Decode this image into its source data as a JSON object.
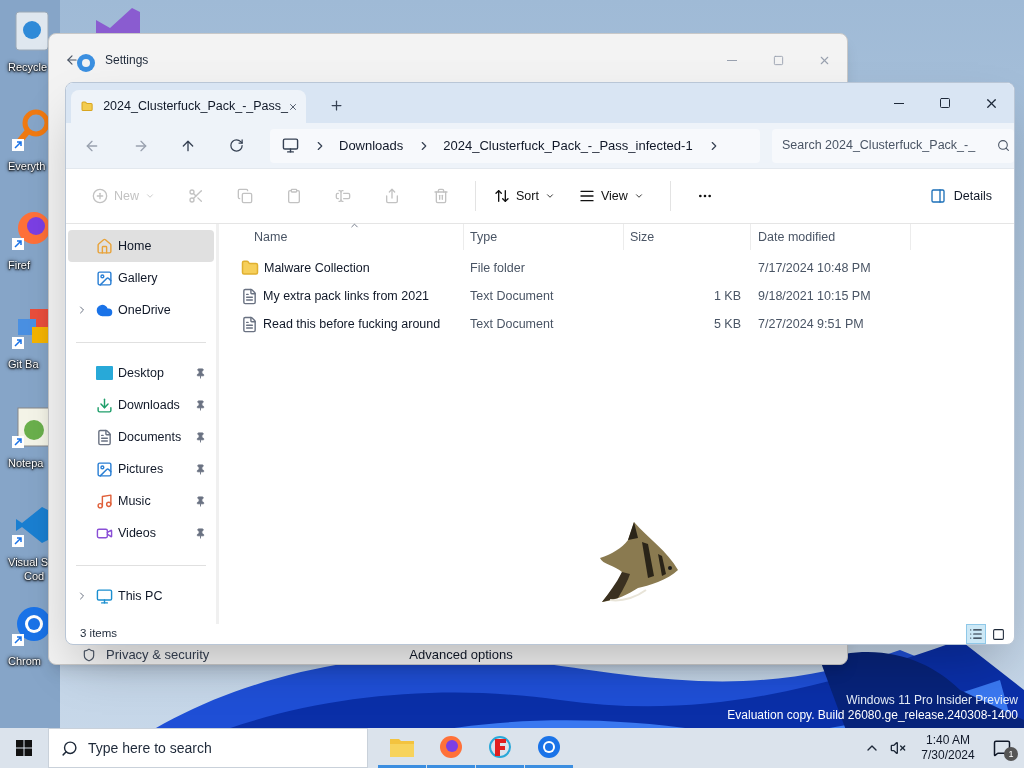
{
  "desktop_icons": [
    {
      "kind": "recycle",
      "lines": [
        "Recycle"
      ]
    },
    {
      "kind": "everything",
      "lines": [
        "Everyth"
      ]
    },
    {
      "kind": "firefox",
      "lines": [
        "Firef"
      ]
    },
    {
      "kind": "git",
      "lines": [
        "Git Ba"
      ]
    },
    {
      "kind": "notepad",
      "lines": [
        "Notepa"
      ]
    },
    {
      "kind": "vscode",
      "lines": [
        "Visual S",
        "Cod"
      ]
    },
    {
      "kind": "chrome",
      "lines": [
        "Chrom"
      ]
    }
  ],
  "settings_window": {
    "title": "Settings",
    "nav_item": "Privacy & security",
    "footer_link": "Advanced options"
  },
  "explorer": {
    "tab_title": "2024_Clusterfuck_Pack_-_Pass_",
    "breadcrumb": [
      "Downloads",
      "2024_Clusterfuck_Pack_-_Pass_infected-1"
    ],
    "search": {
      "placeholder": "Search 2024_Clusterfuck_Pack_-_"
    },
    "toolbar": [
      {
        "kind": "new",
        "label": "New",
        "disabled": true
      },
      {
        "kind": "cut",
        "disabled": true
      },
      {
        "kind": "copy",
        "disabled": true
      },
      {
        "kind": "paste",
        "disabled": true
      },
      {
        "kind": "rename",
        "disabled": true
      },
      {
        "kind": "share",
        "disabled": true
      },
      {
        "kind": "delete",
        "disabled": true
      },
      {
        "kind": "sort",
        "label": "Sort",
        "disabled": false
      },
      {
        "kind": "view",
        "label": "View",
        "disabled": false
      },
      {
        "kind": "more",
        "disabled": false
      }
    ],
    "details_button": "Details",
    "sidebar": {
      "sections": [
        [
          {
            "kind": "home",
            "label": "Home",
            "selected": true,
            "expandable": false,
            "pinned": false
          },
          {
            "kind": "gallery",
            "label": "Gallery",
            "selected": false,
            "expandable": false,
            "pinned": false
          },
          {
            "kind": "onedrive",
            "label": "OneDrive",
            "selected": false,
            "expandable": true,
            "pinned": false
          }
        ],
        [
          {
            "kind": "desktop",
            "label": "Desktop",
            "selected": false,
            "expandable": false,
            "pinned": true
          },
          {
            "kind": "downloads",
            "label": "Downloads",
            "selected": false,
            "expandable": false,
            "pinned": true
          },
          {
            "kind": "documents",
            "label": "Documents",
            "selected": false,
            "expandable": false,
            "pinned": true
          },
          {
            "kind": "pictures",
            "label": "Pictures",
            "selected": false,
            "expandable": false,
            "pinned": true
          },
          {
            "kind": "music",
            "label": "Music",
            "selected": false,
            "expandable": false,
            "pinned": true
          },
          {
            "kind": "videos",
            "label": "Videos",
            "selected": false,
            "expandable": false,
            "pinned": true
          }
        ],
        [
          {
            "kind": "thispc",
            "label": "This PC",
            "selected": false,
            "expandable": true,
            "pinned": false
          }
        ]
      ]
    },
    "table": {
      "columns": [
        {
          "label": "Name",
          "sorted": true
        },
        {
          "label": "Type",
          "sorted": false
        },
        {
          "label": "Size",
          "sorted": false
        },
        {
          "label": "Date modified",
          "sorted": false
        }
      ],
      "rows": [
        {
          "kind": "folder",
          "name": "Malware Collection",
          "type": "File folder",
          "date": "7/17/2024 10:48 PM"
        },
        {
          "kind": "text",
          "name": "My extra pack links from 2021",
          "type": "Text Document",
          "size": "1 KB",
          "date": "9/18/2021 10:15 PM"
        },
        {
          "kind": "text",
          "name": "Read this before fucking around",
          "type": "Text Document",
          "size": "5 KB",
          "date": "7/27/2024 9:51 PM"
        }
      ]
    },
    "status": "3 items",
    "view_buttons": [
      {
        "kind": "details",
        "selected": true
      },
      {
        "kind": "tiles",
        "selected": false
      }
    ]
  },
  "watermark": [
    "Windows 11 Pro Insider Preview",
    "Evaluation copy. Build 26080.ge_release.240308-1400"
  ],
  "taskbar": {
    "search": {
      "placeholder": "Type here to search"
    },
    "apps": [
      {
        "kind": "explorer"
      },
      {
        "kind": "firefox"
      },
      {
        "kind": "redapp"
      },
      {
        "kind": "chrome"
      }
    ],
    "time": "1:40 AM",
    "date": "7/30/2024",
    "notifications": "1"
  }
}
